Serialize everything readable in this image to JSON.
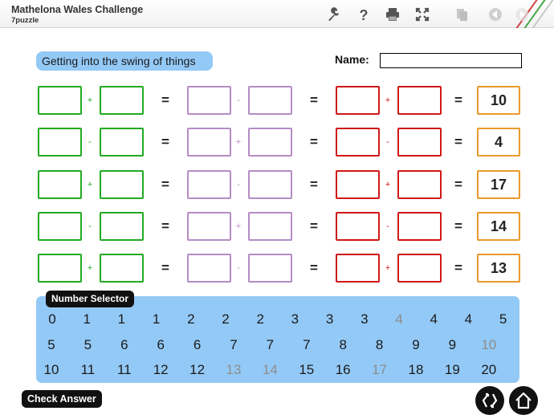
{
  "header": {
    "title": "Mathelona Wales Challenge",
    "subtitle": "7puzzle",
    "icons": [
      "wrench-icon",
      "help-icon",
      "print-icon",
      "fullscreen-icon",
      "copy-icon",
      "back-icon",
      "forward-icon"
    ]
  },
  "puzzle": {
    "heading": "Getting into the swing of things",
    "name_label": "Name:",
    "name_value": "",
    "rows": [
      {
        "op1": "+",
        "op2": "-",
        "op3": "+",
        "equals": "=",
        "target": "10"
      },
      {
        "op1": "-",
        "op2": "+",
        "op3": "-",
        "equals": "=",
        "target": "4"
      },
      {
        "op1": "+",
        "op2": "-",
        "op3": "+",
        "equals": "=",
        "target": "17"
      },
      {
        "op1": "-",
        "op2": "+",
        "op3": "-",
        "equals": "=",
        "target": "14"
      },
      {
        "op1": "+",
        "op2": "-",
        "op3": "+",
        "equals": "=",
        "target": "13"
      }
    ]
  },
  "selector": {
    "label": "Number Selector",
    "numbers": [
      {
        "value": "0",
        "used": false
      },
      {
        "value": "1",
        "used": false
      },
      {
        "value": "1",
        "used": false
      },
      {
        "value": "1",
        "used": false
      },
      {
        "value": "2",
        "used": false
      },
      {
        "value": "2",
        "used": false
      },
      {
        "value": "2",
        "used": false
      },
      {
        "value": "3",
        "used": false
      },
      {
        "value": "3",
        "used": false
      },
      {
        "value": "3",
        "used": false
      },
      {
        "value": "4",
        "used": true
      },
      {
        "value": "4",
        "used": false
      },
      {
        "value": "4",
        "used": false
      },
      {
        "value": "5",
        "used": false
      },
      {
        "value": "5",
        "used": false
      },
      {
        "value": "5",
        "used": false
      },
      {
        "value": "6",
        "used": false
      },
      {
        "value": "6",
        "used": false
      },
      {
        "value": "6",
        "used": false
      },
      {
        "value": "7",
        "used": false
      },
      {
        "value": "7",
        "used": false
      },
      {
        "value": "7",
        "used": false
      },
      {
        "value": "8",
        "used": false
      },
      {
        "value": "8",
        "used": false
      },
      {
        "value": "9",
        "used": false
      },
      {
        "value": "9",
        "used": false
      },
      {
        "value": "10",
        "used": true
      },
      {
        "value": "10",
        "used": false
      },
      {
        "value": "11",
        "used": false
      },
      {
        "value": "11",
        "used": false
      },
      {
        "value": "12",
        "used": false
      },
      {
        "value": "12",
        "used": false
      },
      {
        "value": "13",
        "used": true
      },
      {
        "value": "14",
        "used": true
      },
      {
        "value": "15",
        "used": false
      },
      {
        "value": "16",
        "used": false
      },
      {
        "value": "17",
        "used": true
      },
      {
        "value": "18",
        "used": false
      },
      {
        "value": "19",
        "used": false
      },
      {
        "value": "20",
        "used": false
      }
    ]
  },
  "footer": {
    "check_label": "Check Answer",
    "icons": [
      "swap-icon",
      "home-icon"
    ]
  },
  "colors": {
    "green": "#22aa22",
    "purple": "#b58cc4",
    "red": "#d01818",
    "orange": "#e89a2a",
    "panel_blue": "#93c9f6",
    "used_number": "#8d8d8d"
  }
}
